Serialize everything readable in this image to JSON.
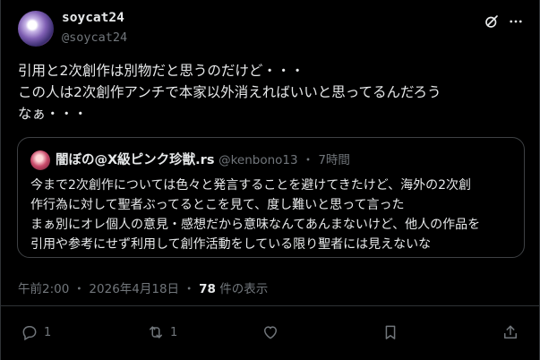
{
  "author": {
    "name": "soycat24",
    "handle": "@soycat24"
  },
  "post": {
    "lines": [
      "引用と2次創作は別物だと思うのだけど・・・",
      "この人は2次創作アンチで本家以外消えればいいと思ってるんだろう",
      "なぁ・・・"
    ]
  },
  "quote": {
    "name": "闇ぼの@X級ピンク珍獣.rs",
    "handle": "@kenbono13",
    "dot": "・",
    "time": "7時間",
    "lines": [
      "今まで2次創作については色々と発言することを避けてきたけど、海外の2次創",
      "作行為に対して聖者ぶってるとこを見て、度し難いと思って言った",
      "まぁ別にオレ個人の意見・感想だから意味なんてあんまないけど、他人の作品を",
      "引用や参考にせず利用して創作活動をしている限り聖者には見えないな"
    ]
  },
  "meta": {
    "time": "午前2:00",
    "sep1": "・",
    "date": "2026年4月18日",
    "sep2": "・",
    "views": "78",
    "views_label": "件の表示"
  },
  "actions": {
    "reply_count": "1",
    "repost_count": "1"
  },
  "icons": {
    "grok": "grok-icon",
    "more": "more-dots-icon",
    "reply": "reply-icon",
    "repost": "repost-icon",
    "like": "heart-icon",
    "bookmark": "bookmark-icon",
    "share": "share-icon"
  },
  "colors": {
    "background": "#000000",
    "text": "#e7e9ea",
    "muted": "#71767b",
    "border": "#2f3336"
  }
}
